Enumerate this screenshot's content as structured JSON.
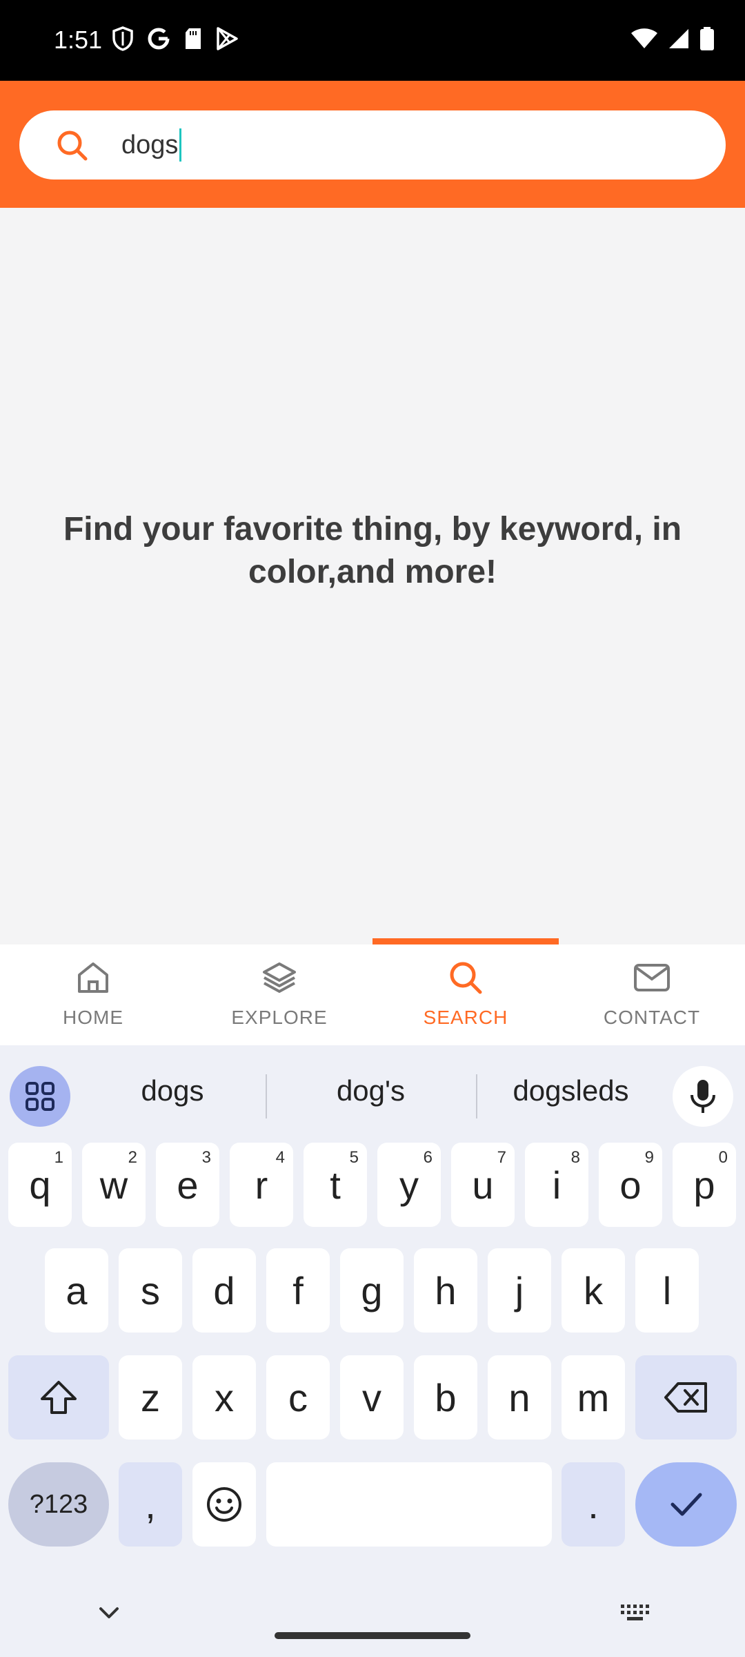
{
  "status_bar": {
    "time": "1:51"
  },
  "search": {
    "value": "dogs"
  },
  "main": {
    "hint": "Find your favorite thing, by keyword, in color,and more!"
  },
  "bottom_nav": {
    "items": [
      {
        "label": "HOME",
        "icon": "home-icon"
      },
      {
        "label": "EXPLORE",
        "icon": "layers-icon"
      },
      {
        "label": "SEARCH",
        "icon": "search-icon"
      },
      {
        "label": "CONTACT",
        "icon": "mail-icon"
      }
    ],
    "active": "SEARCH"
  },
  "keyboard": {
    "suggestions": [
      "dogs",
      "dog's",
      "dogsleds"
    ],
    "row1": [
      {
        "k": "q",
        "h": "1"
      },
      {
        "k": "w",
        "h": "2"
      },
      {
        "k": "e",
        "h": "3"
      },
      {
        "k": "r",
        "h": "4"
      },
      {
        "k": "t",
        "h": "5"
      },
      {
        "k": "y",
        "h": "6"
      },
      {
        "k": "u",
        "h": "7"
      },
      {
        "k": "i",
        "h": "8"
      },
      {
        "k": "o",
        "h": "9"
      },
      {
        "k": "p",
        "h": "0"
      }
    ],
    "row2": [
      "a",
      "s",
      "d",
      "f",
      "g",
      "h",
      "j",
      "k",
      "l"
    ],
    "row3": [
      "z",
      "x",
      "c",
      "v",
      "b",
      "n",
      "m"
    ],
    "symbols_label": "?123",
    "comma": ",",
    "period": "."
  },
  "colors": {
    "accent": "#ff6a24",
    "caret": "#1fc5c0"
  }
}
